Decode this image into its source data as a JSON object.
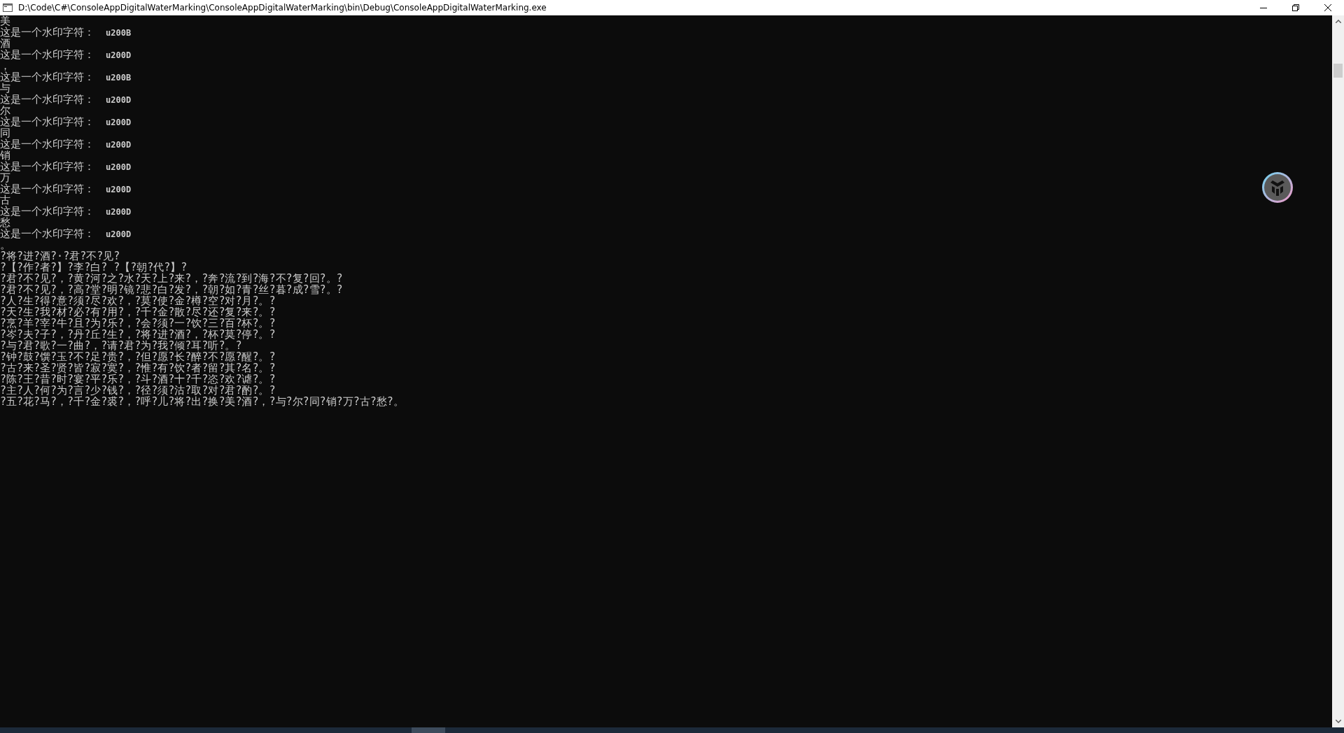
{
  "window": {
    "title": "D:\\Code\\C#\\ConsoleAppDigitalWaterMarking\\ConsoleAppDigitalWaterMarking\\bin\\Debug\\ConsoleAppDigitalWaterMarking.exe"
  },
  "console": {
    "lines": [
      {
        "kind": "text",
        "text": "美"
      },
      {
        "kind": "marker",
        "label": "这是一个水印字符：",
        "code": "u200B"
      },
      {
        "kind": "text",
        "text": "酒"
      },
      {
        "kind": "marker",
        "label": "这是一个水印字符：",
        "code": "u200D"
      },
      {
        "kind": "text",
        "text": "，"
      },
      {
        "kind": "marker",
        "label": "这是一个水印字符：",
        "code": "u200B"
      },
      {
        "kind": "text",
        "text": "与"
      },
      {
        "kind": "marker",
        "label": "这是一个水印字符：",
        "code": "u200D"
      },
      {
        "kind": "text",
        "text": "尔"
      },
      {
        "kind": "marker",
        "label": "这是一个水印字符：",
        "code": "u200D"
      },
      {
        "kind": "text",
        "text": "同"
      },
      {
        "kind": "marker",
        "label": "这是一个水印字符：",
        "code": "u200D"
      },
      {
        "kind": "text",
        "text": "销"
      },
      {
        "kind": "marker",
        "label": "这是一个水印字符：",
        "code": "u200D"
      },
      {
        "kind": "text",
        "text": "万"
      },
      {
        "kind": "marker",
        "label": "这是一个水印字符：",
        "code": "u200D"
      },
      {
        "kind": "text",
        "text": "古"
      },
      {
        "kind": "marker",
        "label": "这是一个水印字符：",
        "code": "u200D"
      },
      {
        "kind": "text",
        "text": "愁"
      },
      {
        "kind": "marker",
        "label": "这是一个水印字符：",
        "code": "u200D"
      },
      {
        "kind": "text",
        "text": "。"
      },
      {
        "kind": "text",
        "text": "?将?进?酒?·?君?不?见?"
      },
      {
        "kind": "text",
        "text": "?【?作?者?】?李?白? ?【?朝?代?】?"
      },
      {
        "kind": "text",
        "text": "?君?不?见?，?黄?河?之?水?天?上?来?，?奔?流?到?海?不?复?回?。?"
      },
      {
        "kind": "text",
        "text": "?君?不?见?，?高?堂?明?镜?悲?白?发?，?朝?如?青?丝?暮?成?雪?。?"
      },
      {
        "kind": "text",
        "text": "?人?生?得?意?须?尽?欢?，?莫?使?金?樽?空?对?月?。?"
      },
      {
        "kind": "text",
        "text": "?天?生?我?材?必?有?用?，?千?金?散?尽?还?复?来?。?"
      },
      {
        "kind": "text",
        "text": "?烹?羊?宰?牛?且?为?乐?，?会?须?一?饮?三?百?杯?。?"
      },
      {
        "kind": "text",
        "text": "?岑?夫?子?，?丹?丘?生?，?将?进?酒?，?杯?莫?停?。?"
      },
      {
        "kind": "text",
        "text": "?与?君?歌?一?曲?，?请?君?为?我?倾?耳?听?。?"
      },
      {
        "kind": "text",
        "text": "?钟?鼓?馔?玉?不?足?贵?，?但?愿?长?醉?不?愿?醒?。?"
      },
      {
        "kind": "text",
        "text": "?古?来?圣?贤?皆?寂?寞?，?惟?有?饮?者?留?其?名?。?"
      },
      {
        "kind": "text",
        "text": "?陈?王?昔?时?宴?平?乐?，?斗?酒?十?千?恣?欢?谑?。?"
      },
      {
        "kind": "text",
        "text": "?主?人?何?为?言?少?钱?，?径?须?沽?取?对?君?酌?。?"
      },
      {
        "kind": "text",
        "text": "?五?花?马?，?千?金?裘?，?呼?儿?将?出?换?美?酒?，?与?尔?同?销?万?古?愁?。"
      }
    ]
  }
}
